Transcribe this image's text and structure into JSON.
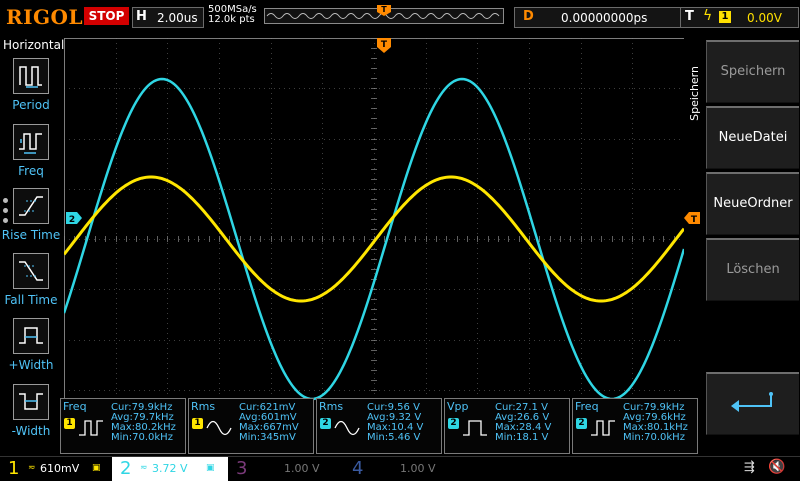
{
  "topbar": {
    "brand": "RIGOL",
    "run_state": "STOP",
    "horizontal_label": "H",
    "timebase": "2.00us",
    "sample_rate": "500MSa/s",
    "memory_depth": "12.0k pts",
    "delay_label": "D",
    "delay_value": "0.00000000ps",
    "trigger_label": "T",
    "trigger_source": "1",
    "trigger_level": "0.00V"
  },
  "left_menu": {
    "title": "Horizontal",
    "items": [
      {
        "label": "Period",
        "icon": "period-icon"
      },
      {
        "label": "Freq",
        "icon": "freq-icon"
      },
      {
        "label": "Rise Time",
        "icon": "rise-time-icon"
      },
      {
        "label": "Fall Time",
        "icon": "fall-time-icon"
      },
      {
        "label": "+Width",
        "icon": "positive-width-icon"
      },
      {
        "label": "-Width",
        "icon": "negative-width-icon"
      }
    ]
  },
  "right_menu": {
    "title": "Speichern",
    "buttons": [
      {
        "label": "Speichern",
        "enabled": false
      },
      {
        "label": "NeueDatei",
        "enabled": true
      },
      {
        "label": "NeueOrdner",
        "enabled": true
      },
      {
        "label": "Löschen",
        "enabled": false
      },
      {
        "label": "",
        "icon": "enter-arrow-icon",
        "enabled": true
      }
    ]
  },
  "markers": {
    "trigger_pos": "T",
    "ch2_ground": "2",
    "trigger_level": "T"
  },
  "measurements": [
    {
      "name": "Freq",
      "source": "1",
      "cur": "Cur:79.9kHz",
      "avg": "Avg:79.7kHz",
      "max": "Max:80.2kHz",
      "min": "Min:70.0kHz"
    },
    {
      "name": "Rms",
      "source": "1",
      "cur": "Cur:621mV",
      "avg": "Avg:601mV",
      "max": "Max:667mV",
      "min": "Min:345mV"
    },
    {
      "name": "Rms",
      "source": "2",
      "cur": "Cur:9.56 V",
      "avg": "Avg:9.32 V",
      "max": "Max:10.4 V",
      "min": "Min:5.46 V"
    },
    {
      "name": "Vpp",
      "source": "2",
      "cur": "Cur:27.1 V",
      "avg": "Avg:26.6 V",
      "max": "Max:28.4 V",
      "min": "Min:18.1 V"
    },
    {
      "name": "Freq",
      "source": "2",
      "cur": "Cur:79.9kHz",
      "avg": "Avg:79.6kHz",
      "max": "Max:80.1kHz",
      "min": "Min:70.0kHz"
    }
  ],
  "channels": [
    {
      "number": "1",
      "scale": "610mV",
      "active": true
    },
    {
      "number": "2",
      "scale": "3.72 V",
      "active": true
    },
    {
      "number": "3",
      "scale": "1.00 V",
      "active": false
    },
    {
      "number": "4",
      "scale": "1.00 V",
      "active": false
    }
  ],
  "colors": {
    "ch1": "#ffe600",
    "ch2": "#2fd6e4",
    "ch3": "#c040c0",
    "ch4": "#3a6fd8",
    "accent": "#ff8a00",
    "menu_text": "#4fc3f7"
  }
}
